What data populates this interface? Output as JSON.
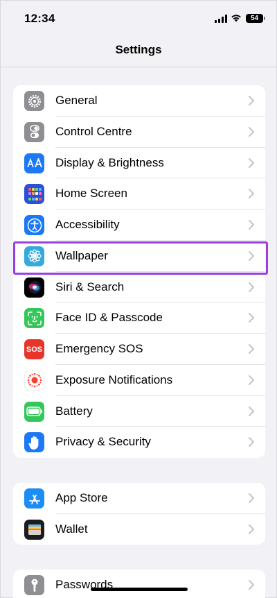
{
  "status_bar": {
    "time": "12:34",
    "battery": "54"
  },
  "nav": {
    "title": "Settings"
  },
  "groups": [
    {
      "items": [
        {
          "label": "General",
          "icon": "gear-icon",
          "color": "#8e8e93"
        },
        {
          "label": "Control Centre",
          "icon": "toggle-switches-icon",
          "color": "#8e8e93"
        },
        {
          "label": "Display & Brightness",
          "icon": "text-size-icon",
          "color": "#1b79f5"
        },
        {
          "label": "Home Screen",
          "icon": "app-grid-icon",
          "color": "#2b50d8"
        },
        {
          "label": "Accessibility",
          "icon": "accessibility-person-icon",
          "color": "#1b79f5"
        },
        {
          "label": "Wallpaper",
          "icon": "flower-icon",
          "color": "#34aadc"
        },
        {
          "label": "Siri & Search",
          "icon": "siri-orb-icon",
          "color": "#000000"
        },
        {
          "label": "Face ID & Passcode",
          "icon": "face-id-icon",
          "color": "#34c759"
        },
        {
          "label": "Emergency SOS",
          "icon": "sos-icon",
          "icon_text": "SOS",
          "color": "#e8352b"
        },
        {
          "label": "Exposure Notifications",
          "icon": "exposure-dots-icon",
          "color": "#ffffff"
        },
        {
          "label": "Battery",
          "icon": "battery-icon",
          "color": "#34c759"
        },
        {
          "label": "Privacy & Security",
          "icon": "hand-raised-icon",
          "color": "#1b79f5"
        }
      ]
    },
    {
      "items": [
        {
          "label": "App Store",
          "icon": "app-store-icon",
          "color": "#1b8df5"
        },
        {
          "label": "Wallet",
          "icon": "wallet-icon",
          "color": "#1c1c1e"
        }
      ]
    },
    {
      "items": [
        {
          "label": "Passwords",
          "icon": "key-icon",
          "color": "#8e8e93"
        }
      ]
    }
  ],
  "highlighted_item": "Wallpaper",
  "highlight_color": "#9b3fe0"
}
